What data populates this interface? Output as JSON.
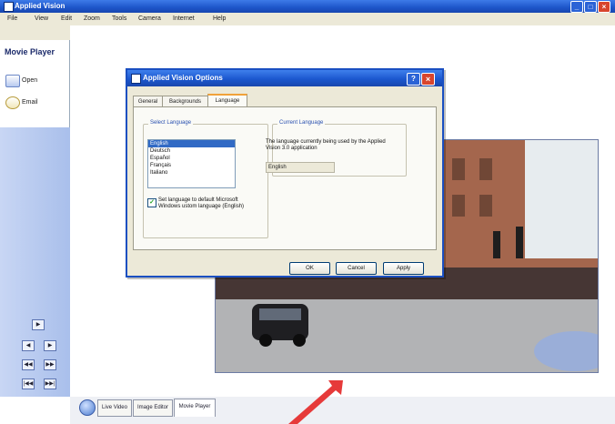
{
  "app": {
    "title": "Applied Vision"
  },
  "menu": [
    "File",
    "View",
    "Edit",
    "Zoom",
    "Tools",
    "Camera",
    "Internet",
    "Help"
  ],
  "left_panel": {
    "header": "Movie Player",
    "items": [
      {
        "label": "Open",
        "icon": "film-icon"
      },
      {
        "label": "Email",
        "icon": "email-icon"
      }
    ],
    "controls": [
      "▶",
      "◀",
      "▶",
      "◀◀",
      "▶▶",
      "|◀◀",
      "▶▶|"
    ]
  },
  "bottom_tabs": [
    "Live Video",
    "Image Editor",
    "Movie Player"
  ],
  "bottom_tabs_active": "Movie Player",
  "dialog": {
    "title": "Applied Vision Options",
    "tabs": [
      "General",
      "Backgrounds",
      "Language"
    ],
    "active_tab": "Language",
    "select_language": {
      "title": "Select Language",
      "options": [
        "English",
        "Deutsch",
        "Español",
        "Français",
        "Italiano"
      ],
      "selected": "English"
    },
    "checkbox": {
      "checked": true,
      "label": "Set language to default Microsoft Windows ustom language (English)"
    },
    "current_language": {
      "title": "Current Language",
      "description": "The language currently being used by the Applied Vision 3.0 application",
      "value": "English"
    },
    "buttons": {
      "ok": "OK",
      "cancel": "Cancel",
      "apply": "Apply"
    }
  },
  "colors": {
    "titlebar": "#1d55c9",
    "panel": "#a9bfeb",
    "dialog_bg": "#ece9d8",
    "selection": "#316ac5",
    "arrow": "#e63a3a"
  }
}
